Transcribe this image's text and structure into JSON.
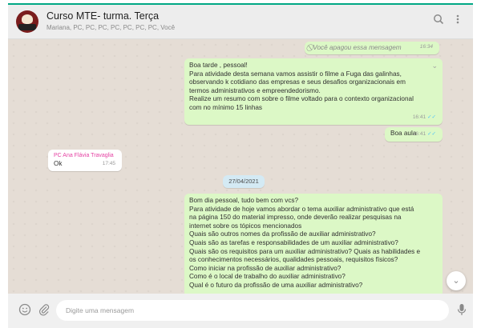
{
  "header": {
    "title": "Curso MTE- turma. Terça",
    "subtitle": "Mariana, PC, PC, PC, PC, PC, PC, PC, Você",
    "icons": [
      "search-icon",
      "menu-icon"
    ]
  },
  "messages": {
    "deleted": {
      "text": "Você apagou essa mensagem",
      "time": "16:34"
    },
    "m1": {
      "lines": [
        "Boa tarde , pessoal!",
        "Para atividade desta semana vamos assistir o filme a Fuga das galinhas,",
        "observando k cotidiano das empresas e seus desafios organizacionais em",
        "termos administrativos e empreendedorismo.",
        "Realize um resumo com sobre o filme  voltado para o contexto organizacional",
        "com no mínimo 15 linhas"
      ],
      "time": "16:41"
    },
    "m2": {
      "text": "Boa aula",
      "time": "16:41"
    },
    "m3": {
      "sender": "PC Ana Flávia Travaglia",
      "text": "Ok",
      "time": "17:45"
    },
    "date_chip": "27/04/2021",
    "m4": {
      "lines": [
        "Bom dia pessoal, tudo bem com vcs?",
        "Para atividade de hoje vamos abordar o tema auxiliar administrativo que está",
        "na página 150 do material impresso, onde deverão realizar pesquisas na",
        "internet sobre os tópicos mencionados",
        "Quais são outros nomes da profissão de auxiliar administrativo?",
        "Quais são as tarefas e responsabilidades de um auxiliar administrativo?",
        "Quais são os requisitos para um auxiliar administrativo? Quais as habilidades e",
        "os conhecimentos necessários, qualidades pessoais, requisitos físicos?",
        "Como iniciar na profissão de auxiliar administrativo?",
        "Como é o local de trabalho do auxiliar administrativo?",
        "Qual é o futuro da profissão de uma auxiliar administrativo?"
      ]
    }
  },
  "footer": {
    "placeholder": "Digite uma mensagem",
    "icons": [
      "emoji-icon",
      "attach-icon",
      "mic-icon"
    ]
  },
  "colors": {
    "accent": "#00a884",
    "outgoing": "#dcf8c6",
    "incoming": "#ffffff",
    "sender_name": "#e542a3"
  }
}
